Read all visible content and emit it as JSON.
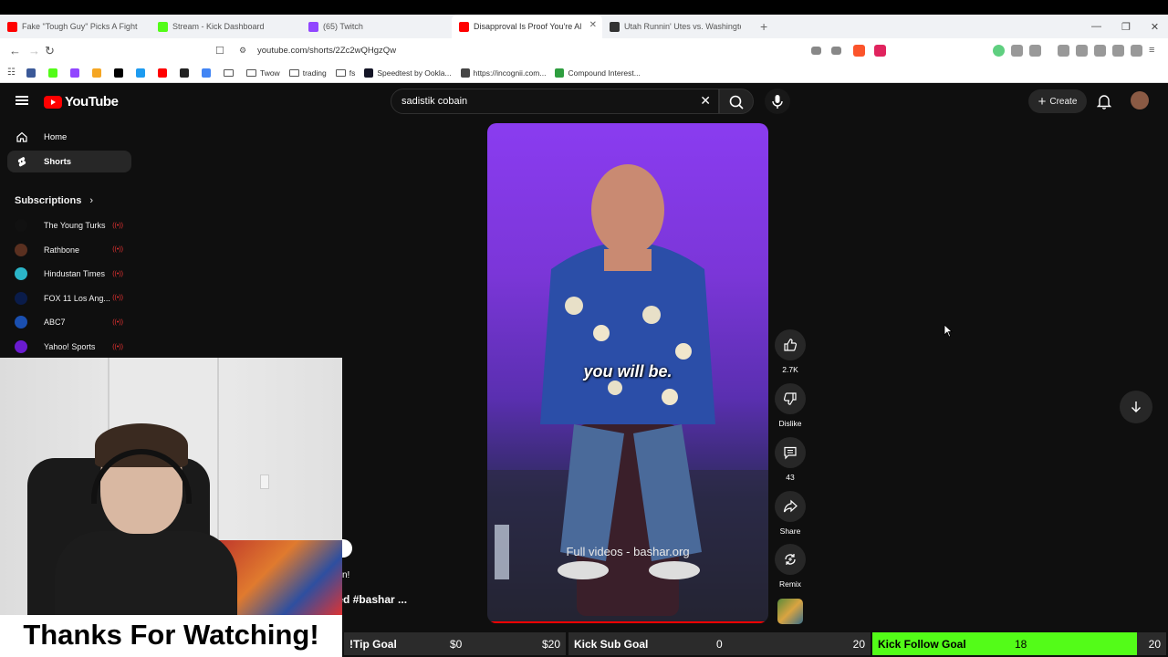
{
  "browser": {
    "tabs": [
      {
        "label": "Fake \"Tough Guy\" Picks A Fight With",
        "color": "#ff0000",
        "active": false
      },
      {
        "label": "Stream - Kick Dashboard",
        "color": "#53fc18",
        "active": false
      },
      {
        "label": "(65) Twitch",
        "color": "#9146ff",
        "active": false
      },
      {
        "label": "Disapproval Is Proof You're Al",
        "color": "#ff0000",
        "active": true
      },
      {
        "label": "Utah Runnin' Utes vs. Washington H",
        "color": "#333333",
        "active": false
      }
    ],
    "url": "youtube.com/shorts/2Zc2wQHgzQw",
    "bookmarks": [
      {
        "label": "",
        "type": "icon",
        "color": "#3b5998"
      },
      {
        "label": "",
        "type": "icon",
        "color": "#53fc18"
      },
      {
        "label": "",
        "type": "icon",
        "color": "#9146ff"
      },
      {
        "label": "",
        "type": "icon",
        "color": "#f5a623"
      },
      {
        "label": "",
        "type": "icon",
        "color": "#000000"
      },
      {
        "label": "",
        "type": "icon",
        "color": "#1d9bf0"
      },
      {
        "label": "",
        "type": "icon",
        "color": "#ff0000"
      },
      {
        "label": "",
        "type": "icon",
        "color": "#222222"
      },
      {
        "label": "",
        "type": "icon",
        "color": "#4285f4"
      },
      {
        "label": "",
        "type": "folder"
      },
      {
        "label": "Twow",
        "type": "folder"
      },
      {
        "label": "trading",
        "type": "folder"
      },
      {
        "label": "fs",
        "type": "folder"
      },
      {
        "label": "Speedtest by Ookla...",
        "type": "icon",
        "color": "#141526"
      },
      {
        "label": "https://incognii.com...",
        "type": "icon",
        "color": "#444444"
      },
      {
        "label": "Compound Interest...",
        "type": "icon",
        "color": "#2e9e3f"
      }
    ]
  },
  "youtube": {
    "logo_text": "YouTube",
    "search": {
      "value": "sadistik cobain"
    },
    "create_label": "Create",
    "sidebar": {
      "items": [
        {
          "label": "Home",
          "icon": "home-icon",
          "selected": false
        },
        {
          "label": "Shorts",
          "icon": "shorts-icon",
          "selected": true
        }
      ],
      "subscriptions_title": "Subscriptions",
      "subscriptions": [
        {
          "label": "The Young Turks",
          "avatar_color": "#111111"
        },
        {
          "label": "Rathbone",
          "avatar_color": "#5a3020"
        },
        {
          "label": "Hindustan Times",
          "avatar_color": "#2bb5c8"
        },
        {
          "label": "FOX 11 Los Ang...",
          "avatar_color": "#0a1c4a"
        },
        {
          "label": "ABC7",
          "avatar_color": "#1a4fb0"
        },
        {
          "label": "Yahoo! Sports",
          "avatar_color": "#6a1bd0"
        }
      ]
    },
    "short": {
      "caption": "you will be.",
      "watermark": "Full videos - bashar.org"
    },
    "actions": [
      {
        "label": "2.7K",
        "icon": "like-icon"
      },
      {
        "label": "Dislike",
        "icon": "dislike-icon"
      },
      {
        "label": "43",
        "icon": "comment-icon"
      },
      {
        "label": "Share",
        "icon": "share-icon"
      },
      {
        "label": "Remix",
        "icon": "remix-icon"
      }
    ],
    "partial_text_1": "n!",
    "partial_text_2": "ned #bashar ..."
  },
  "overlay": {
    "thanks_text": "Thanks For Watching!",
    "goals": [
      {
        "name": "!Tip Goal",
        "current": "$0",
        "target": "$20",
        "progress": 0,
        "bg": "#2b2b2b"
      },
      {
        "name": "Kick Sub Goal",
        "current": "0",
        "target": "20",
        "progress": 0,
        "bg": "#2b2b2b"
      },
      {
        "name": "Kick Follow Goal",
        "current": "18",
        "target": "20",
        "progress": 0.9,
        "bg": "#2b2b2b"
      }
    ]
  }
}
